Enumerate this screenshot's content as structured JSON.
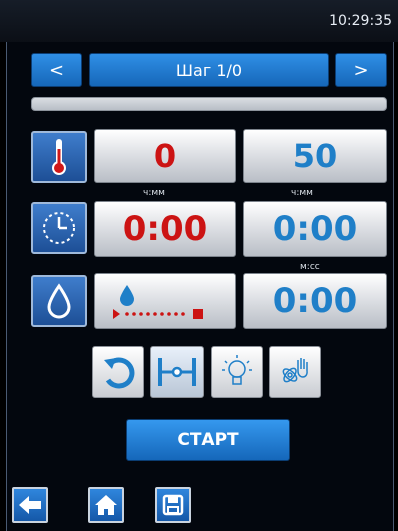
{
  "status_bar": {
    "time": "10:29:35"
  },
  "step_nav": {
    "prev_label": "<",
    "step_label": "Шаг 1/0",
    "next_label": ">"
  },
  "temperature": {
    "icon": "thermometer-icon",
    "set_value": "0",
    "actual_value": "50"
  },
  "time_row": {
    "icon": "clock-icon",
    "unit_left": "ч:мм",
    "unit_right": "ч:мм",
    "set_value": "0:00",
    "actual_value": "0:00"
  },
  "humidity_row": {
    "icon": "water-drop-icon",
    "unit_right": "м:сс",
    "actual_value": "0:00",
    "humidity_slider_icon": "humidity-level-icon"
  },
  "tools": [
    "cycle-icon",
    "probe-icon",
    "lightbulb-icon",
    "hand-fan-icon"
  ],
  "start_label": "СТАРТ",
  "bottom_nav": [
    "back-arrow-icon",
    "home-icon",
    "save-icon"
  ],
  "colors": {
    "accent": "#1f7fc8",
    "set_value": "#cc1313",
    "background": "#000000"
  }
}
